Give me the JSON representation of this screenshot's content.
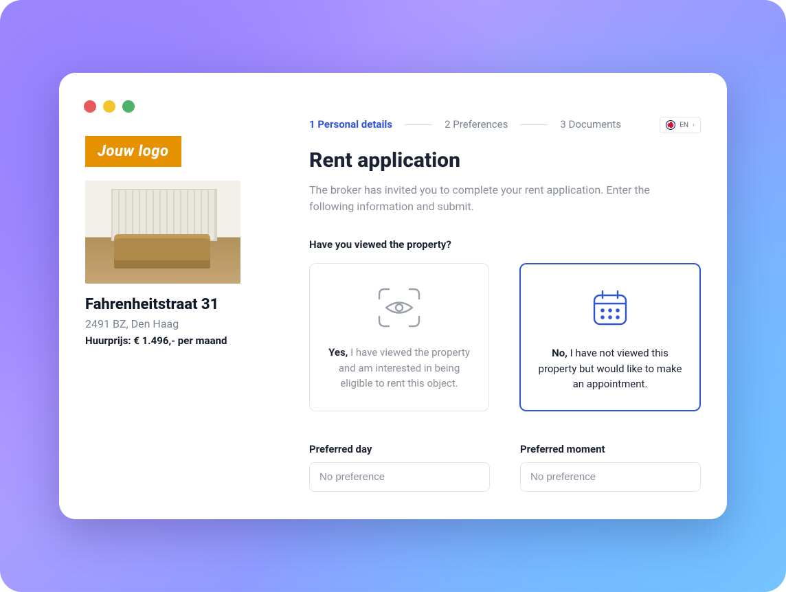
{
  "logo": {
    "label": "Jouw logo"
  },
  "property": {
    "address": "Fahrenheitstraat 31",
    "location": "2491 BZ, Den Haag",
    "price_line": "Huurprijs: € 1.496,- per maand"
  },
  "steps": {
    "s1": "1 Personal details",
    "s2": "2 Preferences",
    "s3": "3 Documents"
  },
  "language": {
    "code": "EN"
  },
  "title": "Rent application",
  "intro": "The broker has invited you to complete your rent application. Enter the following information and submit.",
  "question": "Have you viewed the property?",
  "options": {
    "yes": {
      "lead": "Yes,",
      "body": " I have viewed the property and am interested in being eligible to rent this object."
    },
    "no": {
      "lead": "No,",
      "body": " I have not viewed this property but would like to make an appointment."
    }
  },
  "fields": {
    "day": {
      "label": "Preferred day",
      "value": "No preference"
    },
    "moment": {
      "label": "Preferred moment",
      "value": "No preference"
    }
  }
}
